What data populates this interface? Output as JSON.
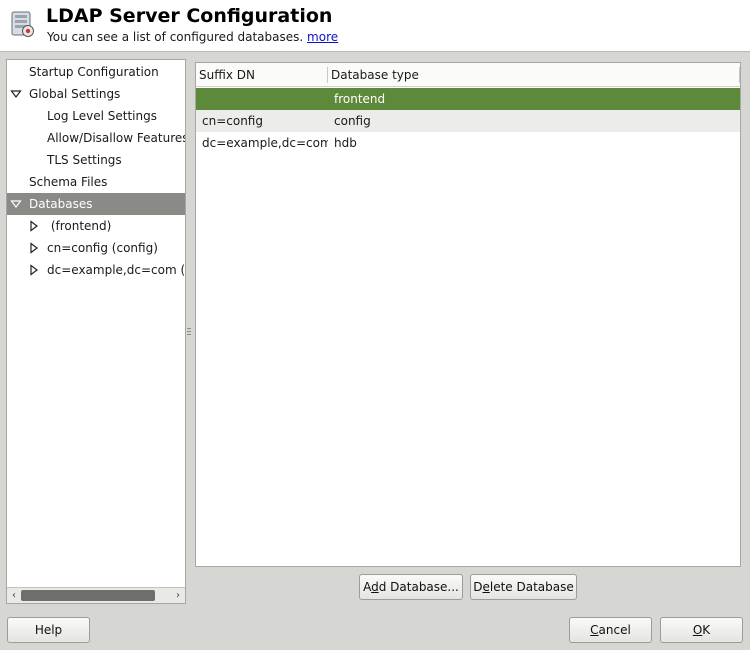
{
  "header": {
    "title": "LDAP Server Configuration",
    "subtitle": "You can see a list of configured databases.",
    "more_link": "more",
    "icon": "ldap-server-icon"
  },
  "tree": {
    "items": [
      {
        "label": "Startup Configuration"
      },
      {
        "label": "Global Settings",
        "expander": "expanded"
      },
      {
        "label": "Log Level Settings"
      },
      {
        "label": "Allow/Disallow Features"
      },
      {
        "label": "TLS Settings"
      },
      {
        "label": "Schema Files"
      },
      {
        "label": "Databases",
        "expander": "expanded",
        "selected": true
      },
      {
        "label": " (frontend)",
        "expander": "collapsed"
      },
      {
        "label": "cn=config (config)",
        "expander": "collapsed"
      },
      {
        "label": "dc=example,dc=com (h",
        "expander": "collapsed"
      }
    ],
    "scroll_left": "‹",
    "scroll_right": "›"
  },
  "table": {
    "columns": [
      "Suffix DN",
      "Database type"
    ],
    "rows": [
      {
        "suffix_dn": "",
        "db_type": "frontend",
        "selected": true
      },
      {
        "suffix_dn": "cn=config",
        "db_type": "config"
      },
      {
        "suffix_dn": "dc=example,dc=com",
        "db_type": "hdb"
      }
    ]
  },
  "buttons": {
    "add_database": {
      "pre": "A",
      "mnemonic": "d",
      "post": "d Database..."
    },
    "delete_database": {
      "pre": "D",
      "mnemonic": "e",
      "post": "lete Database"
    },
    "help": "Help",
    "cancel": {
      "pre": "",
      "mnemonic": "C",
      "post": "ancel"
    },
    "ok": {
      "pre": "",
      "mnemonic": "O",
      "post": "K"
    }
  },
  "colors": {
    "selection_green": "#5d8a3a",
    "tree_selection": "#8a8b87",
    "link": "#1010c8"
  }
}
